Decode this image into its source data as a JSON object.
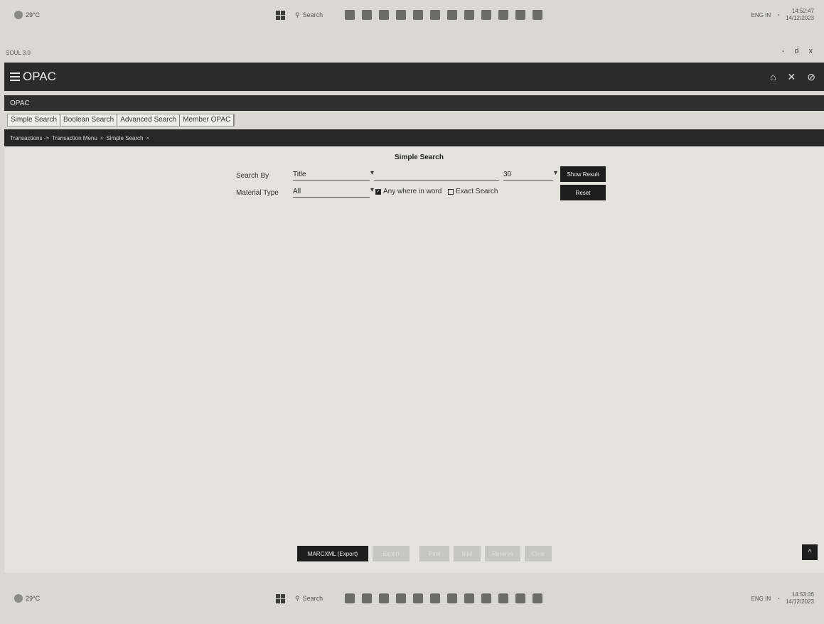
{
  "os_taskbar": {
    "weather_temp": "29°C",
    "search_label": "Search",
    "clock_time_top": "14:52:47",
    "clock_date_top": "14/12/2023",
    "clock_time_bottom": "14:53:06",
    "clock_date_bottom": "14/12/2023",
    "lang": "ENG IN"
  },
  "window": {
    "title": "SOUL 3.0",
    "minimize": "-",
    "maximize": "d",
    "close": "x"
  },
  "header": {
    "app_title": "OPAC",
    "home_icon": "⌂",
    "close_icon": "✕",
    "help_icon": "⊘"
  },
  "subheader": {
    "title": "OPAC"
  },
  "tabs": [
    {
      "label": "Simple Search"
    },
    {
      "label": "Boolean Search"
    },
    {
      "label": "Advanced Search"
    },
    {
      "label": "Member OPAC"
    }
  ],
  "breadcrumb": {
    "items": [
      "Transactions ->",
      "Transaction Menu",
      "×",
      "Simple Search",
      "×"
    ]
  },
  "form": {
    "title": "Simple Search",
    "search_by_label": "Search By",
    "search_by_value": "Title",
    "search_text_value": "",
    "count_value": "30",
    "material_type_label": "Material Type",
    "material_type_value": "All",
    "anywhere_label": "Any where in word",
    "anywhere_checked": true,
    "exact_label": "Exact Search",
    "exact_checked": false,
    "show_result": "Show Result",
    "reset": "Reset"
  },
  "bottom_actions": {
    "marcxml": "MARCXML (Export)",
    "b2": "Export",
    "b3": "Print",
    "b4": "Mail",
    "b5": "Reserve",
    "b6": "Clear"
  },
  "scroll_top": "^"
}
